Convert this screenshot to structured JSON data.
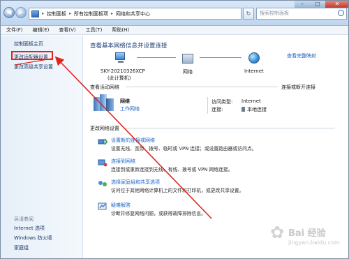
{
  "address_bar": {
    "crumbs": [
      "控制面板",
      "所有控制面板项",
      "网络和共享中心"
    ]
  },
  "search": {
    "placeholder": "搜索控制面板"
  },
  "menu": [
    "文件(F)",
    "编辑(E)",
    "查看(V)",
    "工具(T)",
    "帮助(H)"
  ],
  "left_pane": {
    "links": [
      "控制面板主页",
      "更改适配器设置",
      "更改高级共享设置"
    ],
    "see_also_heading": "另请参阅",
    "see_also": [
      "Internet 选项",
      "Windows 防火墙",
      "家庭组"
    ]
  },
  "main": {
    "title": "查看基本网络信息并设置连接",
    "full_map_link": "查看完整映射",
    "network_map": {
      "computer_name": "SKY-20210326XCP",
      "computer_sub": "(此计算机)",
      "network": "网络",
      "internet": "Internet"
    },
    "active_networks_label": "查看活动网络",
    "connect_disconnect_link": "连接或断开连接",
    "active_network": {
      "name": "网络",
      "type": "工作网络",
      "access_type_key": "访问类型:",
      "access_type_val": "Internet",
      "connections_key": "连接:",
      "connections_val": "本地连接"
    },
    "change_settings_label": "更改网络设置",
    "tasks": [
      {
        "title": "设置新的连接或网络",
        "desc": "设置无线、宽带、拨号、临时或 VPN 连接；或设置路由器或访问点。"
      },
      {
        "title": "连接到网络",
        "desc": "连接到或重新连接到无线、有线、拨号或 VPN 网络连接。"
      },
      {
        "title": "选择家庭组和共享选项",
        "desc": "访问位于其他网络计算机上的文件和打印机，或更改共享设置。"
      },
      {
        "title": "疑难解答",
        "desc": "诊断并修复网络问题，或获得故障排除信息。"
      }
    ]
  },
  "watermark": {
    "text": "Bai 经验",
    "url": "jingyan.baidu.com"
  },
  "colors": {
    "link": "#1c64c4",
    "highlight": "#e0251c"
  }
}
